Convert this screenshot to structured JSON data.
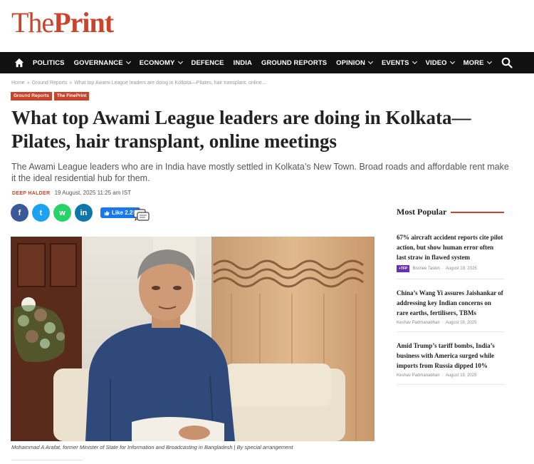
{
  "logo": {
    "the": "The",
    "print": "Print"
  },
  "nav": {
    "items": [
      {
        "label": "POLITICS",
        "dropdown": false
      },
      {
        "label": "GOVERNANCE",
        "dropdown": true
      },
      {
        "label": "ECONOMY",
        "dropdown": true
      },
      {
        "label": "DEFENCE",
        "dropdown": false
      },
      {
        "label": "INDIA",
        "dropdown": false
      },
      {
        "label": "GROUND REPORTS",
        "dropdown": false
      },
      {
        "label": "OPINION",
        "dropdown": true
      },
      {
        "label": "EVENTS",
        "dropdown": true
      },
      {
        "label": "VIDEO",
        "dropdown": true
      },
      {
        "label": "MORE",
        "dropdown": true
      }
    ]
  },
  "breadcrumb": {
    "home": "Home",
    "section": "Ground Reports",
    "current": "What top Awami League leaders are doing in Kolkata—Pilates, hair transplant, online..."
  },
  "tags": [
    "Ground Reports",
    "The FinePrint"
  ],
  "article": {
    "headline": "What top Awami League leaders are doing in Kolkata—Pilates, hair transplant, online meetings",
    "dek": "The Awami League leaders who are in India have mostly settled in Kolkata’s New Town. Broad roads and affordable rent make it the ideal residential hub for them.",
    "author": "DEEP HALDER",
    "date": "19 August, 2025 11:25 am IST",
    "caption": "Mohammad A Arafat, former Minister of State for Information and Broadcasting in Bangladesh | By special arrangement"
  },
  "share": {
    "facebook": "f",
    "twitter": "t",
    "whatsapp": "w",
    "linkedin": "in",
    "like_label": "Like 2.2K"
  },
  "sidebar": {
    "title": "Most Popular",
    "stories": [
      {
        "title": "67% aircraft accident reports cite pilot action, but show human error often last straw in flawed system",
        "badge": "+TFP",
        "author": "Bismee Taskin",
        "date": "August 19, 2025"
      },
      {
        "title": "China’s Wang Yi assures Jaishankar of addressing key Indian concerns on rare earths, fertilisers, TBMs",
        "badge": "",
        "author": "Keshav Padmanabhan",
        "date": "August 19, 2025"
      },
      {
        "title": "Amid Trump’s tariff bombs, India’s business with America surged while imports from Russia dipped 10%",
        "badge": "",
        "author": "Keshav Padmanabhan",
        "date": "August 19, 2025"
      }
    ]
  },
  "colors": {
    "brand": "#c9442a",
    "nav_bg": "#111111",
    "tfp": "#6a2fb3"
  }
}
